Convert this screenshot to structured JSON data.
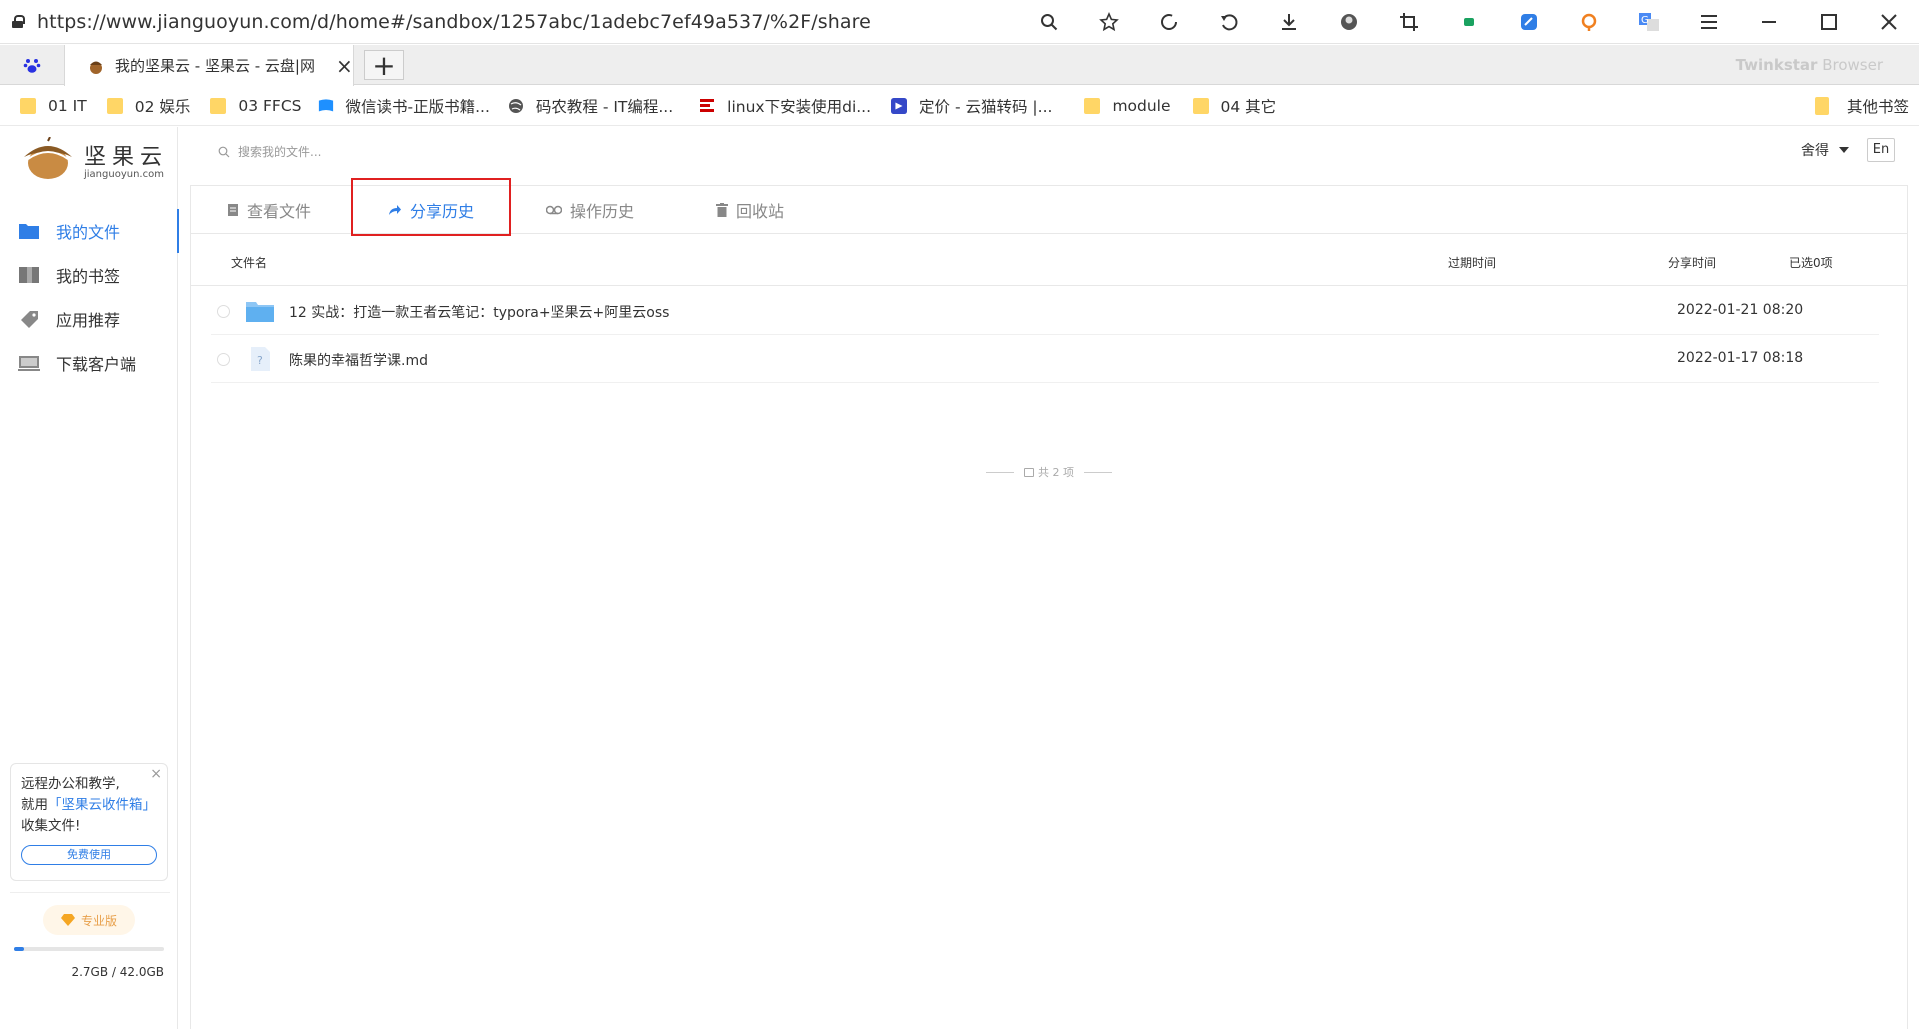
{
  "browser": {
    "url": "https://www.jianguoyun.com/d/home#/sandbox/1257abc/1adebc7ef49a537/%2F/share",
    "tab_title": "我的坚果云 - 坚果云 - 云盘|网",
    "tab_close": "×",
    "new_tab": "+",
    "brand": "Twinkstar",
    "brand_suffix": " Browser",
    "bookmarks": [
      {
        "label": "01 IT",
        "icon": "folder-icon"
      },
      {
        "label": "02 娱乐",
        "icon": "folder-icon"
      },
      {
        "label": "03 FFCS",
        "icon": "folder-icon"
      },
      {
        "label": "微信读书-正版书籍...",
        "icon": "weread-icon"
      },
      {
        "label": "码农教程 - IT编程...",
        "icon": "globe-icon"
      },
      {
        "label": "linux下安装使用di...",
        "icon": "site-icon"
      },
      {
        "label": "定价 - 云猫转码 |...",
        "icon": "yunmao-icon"
      },
      {
        "label": "module",
        "icon": "folder-icon"
      },
      {
        "label": "04 其它",
        "icon": "folder-icon"
      }
    ],
    "other_bookmarks": "其他书签"
  },
  "app": {
    "logo_cn": "坚果云",
    "logo_en": "jianguoyun.com",
    "nav": [
      {
        "label": "我的文件",
        "icon": "folder-icon",
        "active": true
      },
      {
        "label": "我的书签",
        "icon": "bookmark-icon",
        "active": false
      },
      {
        "label": "应用推荐",
        "icon": "tag-icon",
        "active": false
      },
      {
        "label": "下载客户端",
        "icon": "monitor-icon",
        "active": false
      }
    ],
    "promo": {
      "line1": "远程办公和教学,",
      "line2_prefix": "就用",
      "line2_highlight": "「坚果云收件箱」",
      "line3": "收集文件!",
      "button": "免费使用",
      "close": "×"
    },
    "pro_badge": "专业版",
    "storage": {
      "text": "2.7GB / 42.0GB",
      "used_fraction": 0.064
    },
    "search_placeholder": "搜索我的文件...",
    "user_menu": "舍得",
    "lang_button": "En",
    "tabs": [
      {
        "label": "查看文件",
        "icon": "file-icon"
      },
      {
        "label": "分享历史",
        "icon": "share-icon",
        "active": true
      },
      {
        "label": "操作历史",
        "icon": "history-icon"
      },
      {
        "label": "回收站",
        "icon": "trash-icon"
      }
    ],
    "table": {
      "col_name": "文件名",
      "col_expire": "过期时间",
      "col_share_time": "分享时间",
      "col_selected": "已选0项",
      "rows": [
        {
          "name": "12 实战：打造一款王者云笔记：typora+坚果云+阿里云oss",
          "type": "folder",
          "shared": "2022-01-21 08:20"
        },
        {
          "name": "陈果的幸福哲学课.md",
          "type": "unknown",
          "shared": "2022-01-17 08:18"
        }
      ],
      "footer": "共 2 项"
    }
  }
}
